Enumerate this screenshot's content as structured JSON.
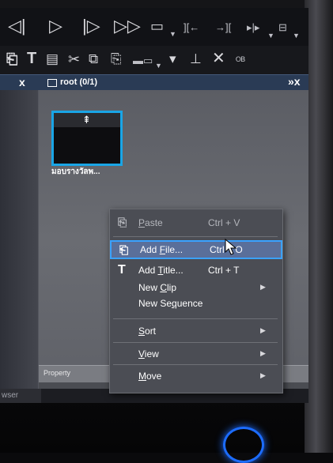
{
  "toolbar": {
    "row1_icons": [
      "step-back-icon",
      "play-icon",
      "step-forward-icon",
      "fast-forward-icon",
      "comment-icon",
      "mark-in-icon",
      "mark-out-icon",
      "mark-clip-icon",
      "snapshot-icon"
    ],
    "row2_icons": [
      "add-file-icon",
      "add-title-icon",
      "color-bars-icon",
      "cut-icon",
      "copy-icon",
      "paste-icon",
      "timeline-icon",
      "insert-icon",
      "lift-icon",
      "delete-icon",
      "ripple-icon"
    ]
  },
  "panel": {
    "close_glyph": "x",
    "title": "root (0/1)",
    "overflow_glyph": "»x"
  },
  "bin": {
    "clip_name": "มอบรางวัลพ...",
    "property_label": "Property"
  },
  "left_pane": {
    "label": "wser"
  },
  "context_menu": {
    "items": [
      {
        "label": "Paste",
        "underline": "P",
        "rest": "aste",
        "shortcut": "Ctrl + V",
        "disabled": true,
        "icon": "paste-icon"
      },
      {
        "label": "Add File...",
        "pre": "Add ",
        "underline": "F",
        "rest": "ile...",
        "shortcut": "Ctrl + O",
        "highlighted": true,
        "icon": "add-file-icon"
      },
      {
        "label": "Add Title...",
        "pre": "Add ",
        "underline": "T",
        "rest": "itle...",
        "shortcut": "Ctrl + T",
        "icon": "title-icon"
      },
      {
        "label": "New Clip",
        "pre": "New ",
        "underline": "C",
        "rest": "lip",
        "submenu": true
      },
      {
        "label": "New Sequence",
        "pre": "New Se",
        "underline": "q",
        "rest": "uence"
      },
      {
        "label": "Sort",
        "underline": "S",
        "rest": "ort",
        "submenu": true
      },
      {
        "label": "View",
        "underline": "V",
        "rest": "iew",
        "submenu": true
      },
      {
        "label": "Move",
        "underline": "M",
        "rest": "ove",
        "submenu": true
      }
    ]
  },
  "colors": {
    "highlight_border": "#3aa2ff",
    "selection_border": "#19a5e6",
    "power_led": "#1c6cff"
  }
}
